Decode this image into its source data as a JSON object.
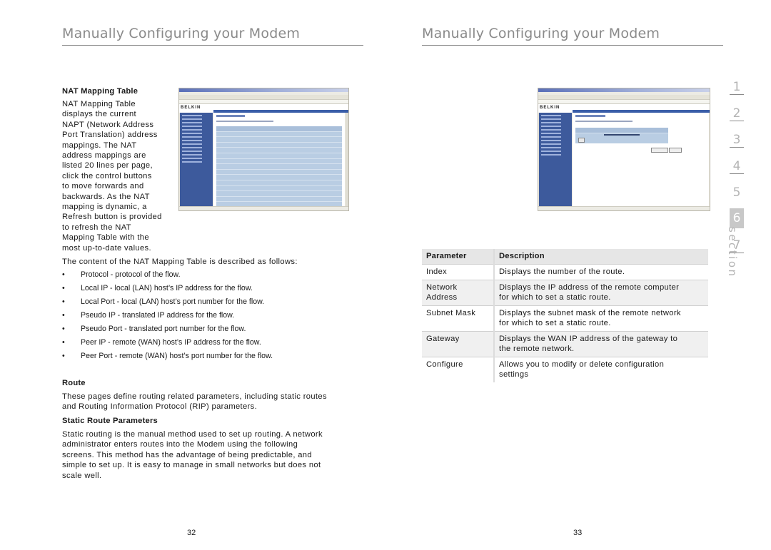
{
  "left_page": {
    "header": "Manually Configuring your Modem",
    "nat_heading": "NAT Mapping Table",
    "nat_paragraph_lines": [
      "NAT Mapping Table",
      "displays the current",
      "NAPT (Network Address",
      "Port Translation) address",
      "mappings. The NAT",
      "address mappings are",
      "listed 20 lines per page,",
      "click the control buttons",
      "to move forwards and",
      "backwards. As the NAT",
      "mapping is dynamic, a",
      "Refresh button is provided",
      "to refresh the NAT",
      "Mapping Table with the",
      "most up-to-date values."
    ],
    "screenshot": {
      "brand": "BELKIN",
      "description": "NAT Mapping Table browser screenshot"
    },
    "content_intro": "The content of the NAT Mapping Table is described as follows:",
    "bullet_glyph": "•",
    "bullets": [
      "Protocol - protocol of the flow.",
      "Local IP - local (LAN) host’s IP address for the flow.",
      "Local Port - local (LAN) host’s port number for the flow.",
      "Pseudo IP - translated IP address for the flow.",
      "Pseudo Port - translated port number for the flow.",
      "Peer IP - remote (WAN) host’s IP address for the flow.",
      "Peer Port - remote (WAN) host’s port number for the flow."
    ],
    "route_heading": "Route",
    "route_paragraph_lines": [
      "These pages define routing related parameters, including static routes",
      "and Routing Information Protocol (RIP) parameters."
    ],
    "static_heading": "Static Route Parameters",
    "static_paragraph_lines": [
      "Static routing is the manual method used to set up routing. A network",
      "administrator enters routes into the Modem using the following",
      "screens. This method has the advantage of being predictable, and",
      "simple to set up. It is easy to manage in small networks but does not",
      "scale well."
    ],
    "page_number": "32"
  },
  "right_page": {
    "header": "Manually Configuring your Modem",
    "screenshot": {
      "brand": "BELKIN",
      "description": "Static Route Parameters browser screenshot"
    },
    "table": {
      "headers": [
        "Parameter",
        "Description"
      ],
      "rows": [
        {
          "parameter": [
            "Index"
          ],
          "description": [
            "Displays the number of the route."
          ]
        },
        {
          "parameter": [
            "Network",
            "Address"
          ],
          "description": [
            "Displays the IP address of the remote computer",
            "for which to set a static route."
          ]
        },
        {
          "parameter": [
            "Subnet Mask"
          ],
          "description": [
            "Displays the subnet mask of the remote network",
            "for which to set a static route."
          ]
        },
        {
          "parameter": [
            "Gateway"
          ],
          "description": [
            "Displays the WAN IP address of the gateway to",
            "the remote network."
          ]
        },
        {
          "parameter": [
            "Configure"
          ],
          "description": [
            "Allows you to modify or delete configuration",
            "settings"
          ]
        }
      ]
    },
    "page_number": "33"
  },
  "section_nav": {
    "items": [
      "1",
      "2",
      "3",
      "4",
      "5",
      "6",
      "7"
    ],
    "active": "6",
    "label": "section"
  },
  "colors": {
    "header_gray": "#8a8a8a",
    "tab_active_bg": "#c8c8c8",
    "sidebar_blue": "#3d5a9c",
    "grid_blue": "#b9cde3"
  }
}
